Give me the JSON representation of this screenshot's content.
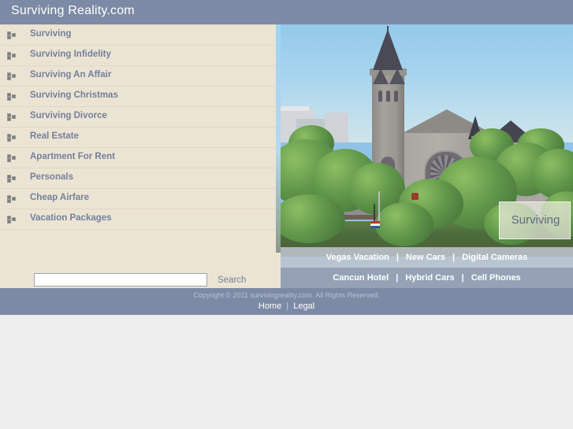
{
  "header": {
    "site_title": "Surviving Reality.com",
    "bg_color": "#7d8aa5"
  },
  "sidebar": {
    "bg_color": "#ece4d3",
    "link_color": "#73809c",
    "bullet_icon": "three-squares-bullet-icon",
    "items": [
      {
        "label": "Surviving"
      },
      {
        "label": "Surviving Infidelity"
      },
      {
        "label": "Surviving An Affair"
      },
      {
        "label": "Surviving Christmas"
      },
      {
        "label": "Surviving Divorce"
      },
      {
        "label": "Real Estate"
      },
      {
        "label": "Apartment For Rent"
      },
      {
        "label": "Personals"
      },
      {
        "label": "Cheap Airfare"
      },
      {
        "label": "Vacation Packages"
      }
    ]
  },
  "search": {
    "value": "",
    "placeholder": "",
    "button_label": "Search"
  },
  "photo": {
    "description": "stone-church-with-spire-and-trees-photo",
    "badge_label": "Surviving"
  },
  "promo_bands": {
    "row1": [
      {
        "label": "Vegas Vacation"
      },
      {
        "label": "New Cars"
      },
      {
        "label": "Digital Cameras"
      }
    ],
    "row2": [
      {
        "label": "Cancun Hotel"
      },
      {
        "label": "Hybrid Cars"
      },
      {
        "label": "Cell Phones"
      }
    ],
    "separator": "|"
  },
  "footer": {
    "copyright": "Copyright © 2011 survivingreality.com. All Rights Reserved.",
    "links": [
      {
        "label": "Home"
      },
      {
        "label": "Legal"
      }
    ],
    "separator": "|",
    "bg_color": "#7d8aa5"
  }
}
